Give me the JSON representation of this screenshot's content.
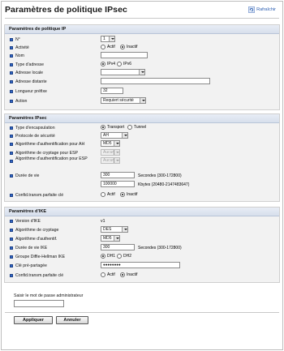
{
  "page": {
    "title": "Paramètres de politique IPsec",
    "refresh_label": "Rafraîchir"
  },
  "ip_section": {
    "header": "Paramètres de politique IP",
    "no_label": "N°",
    "no_value": "1",
    "activity_label": "Activité",
    "activity_options": [
      "Actif",
      "Inactif"
    ],
    "activity_selected": "Inactif",
    "name_label": "Nom",
    "name_value": "",
    "address_type_label": "Type d'adresse",
    "address_type_options": [
      "IPv4",
      "IPv6"
    ],
    "address_type_selected": "IPv4",
    "local_address_label": "Adresse locale",
    "local_address_value": "",
    "remote_address_label": "Adresse distante",
    "remote_address_value": "",
    "prefix_label": "Longueur préfixe",
    "prefix_value": "32",
    "action_label": "Action",
    "action_value": "Requiert sécurité"
  },
  "ipsec_section": {
    "header": "Paramètres IPsec",
    "encap_label": "Type d'encapsulation",
    "encap_options": [
      "Transport",
      "Tunnel"
    ],
    "encap_selected": "Transport",
    "protocol_label": "Protocole de sécurité",
    "protocol_value": "AH",
    "ah_auth_label": "Algorithme d'authentification pour AH",
    "ah_auth_value": "MD5",
    "esp_crypt_label": "Algorithme de cryptage pour ESP",
    "esp_crypt_value": "Aucun",
    "esp_auth_label": "Algorithme d'authentification pour ESP",
    "esp_auth_value": "Aucun",
    "lifetime_label": "Durée de vie",
    "lifetime_seconds_value": "300",
    "lifetime_seconds_suffix": "Secondes (300-172800)",
    "lifetime_kb_value": "100000",
    "lifetime_kb_suffix": "Kbytes (20480-2147483647)",
    "pfs_label": "Confid.transm.parfaite clé",
    "pfs_options": [
      "Actif",
      "Inactif"
    ],
    "pfs_selected": "Inactif"
  },
  "ike_section": {
    "header": "Paramètres d'IKE",
    "version_label": "Version d'IKE",
    "version_value": "v1",
    "crypt_label": "Algorithme de cryptage",
    "crypt_value": "DES",
    "auth_label": "Algorithme d'authentif.",
    "auth_value": "MD5",
    "lifetime_label": "Durée de vie IKE",
    "lifetime_value": "300",
    "lifetime_suffix": "Secondes (300-172800)",
    "dh_label": "Groupe Diffie-Hellman IKE",
    "dh_options": [
      "DH1",
      "DH2"
    ],
    "dh_selected": "DH1",
    "psk_label": "Clé pré-partagée",
    "psk_value": "●●●●●●●●",
    "pfs_label": "Confid.transm.parfaite clé",
    "pfs_options": [
      "Actif",
      "Inactif"
    ],
    "pfs_selected": "Inactif"
  },
  "admin": {
    "password_label": "Saisir le mot de passe administrateur",
    "password_value": ""
  },
  "buttons": {
    "apply": "Appliquer",
    "cancel": "Annuler"
  },
  "colors": {
    "bullet": "#2f66c7",
    "header_bg": "#d7dfec",
    "refresh_link": "#2a5db0"
  }
}
